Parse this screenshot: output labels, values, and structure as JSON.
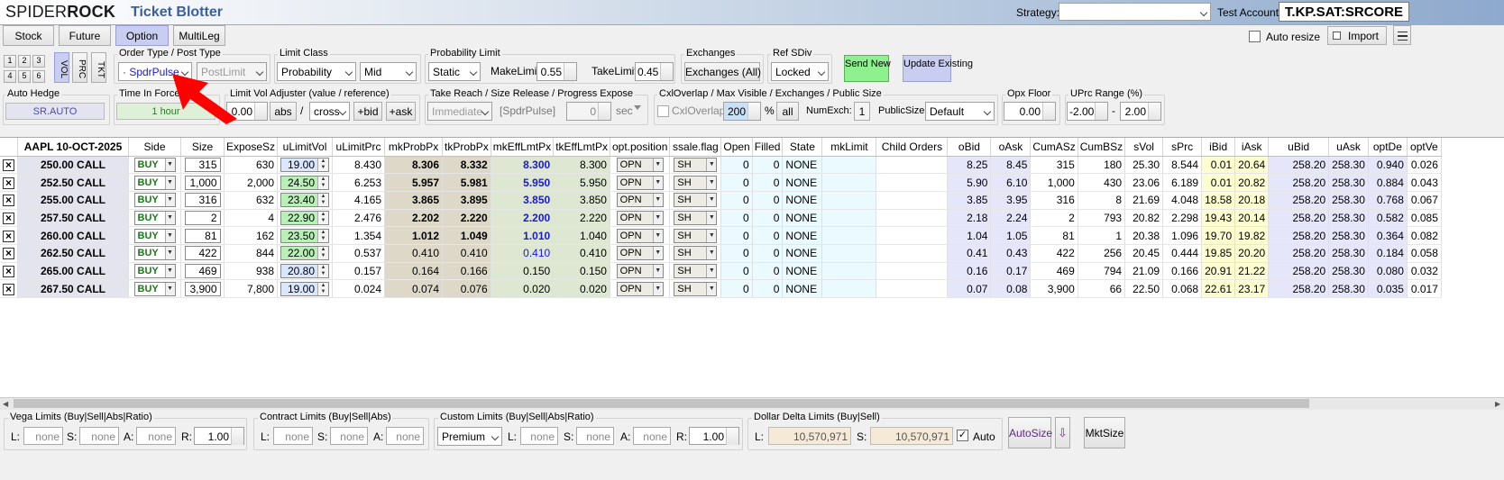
{
  "header": {
    "logo_light": "SPIDER",
    "logo_bold": "ROCK",
    "app_title": "Ticket Blotter",
    "strategy_label": "Strategy:",
    "strategy_value": "",
    "test_account_label": "Test Account:",
    "test_account_value": "T.KP.SAT:SRCORE"
  },
  "tabs": [
    {
      "label": "Stock",
      "active": false
    },
    {
      "label": "Future",
      "active": false
    },
    {
      "label": "Option",
      "active": true
    },
    {
      "label": "MultiLeg",
      "active": false
    }
  ],
  "toolbar_right": {
    "auto_resize_label": "Auto resize",
    "auto_resize_checked": false,
    "import_label": "Import"
  },
  "mini_buttons": [
    "1",
    "2",
    "3",
    "4",
    "5",
    "6"
  ],
  "vertical_tabs": [
    "VOL",
    "PRC",
    "TKT"
  ],
  "order_type": {
    "title": "Order Type / Post Type",
    "order_type_value": "· SpdrPulse",
    "post_type_value": "PostLimit"
  },
  "limit_class": {
    "title": "Limit Class",
    "class_value": "Probability",
    "ref_value": "Mid"
  },
  "probability_limit": {
    "title": "Probability Limit",
    "mode_value": "Static",
    "make_limit_label": "MakeLimit:",
    "make_limit_value": "0.55",
    "take_limit_label": "TakeLimit",
    "take_limit_value": "0.45"
  },
  "exchanges": {
    "title": "Exchanges",
    "button_label": "Exchanges (All)"
  },
  "ref_sdiv": {
    "title": "Ref SDiv",
    "value": "Locked"
  },
  "send_new_label": "Send New",
  "update_existing_label": "Update Existing",
  "auto_hedge": {
    "title": "Auto Hedge",
    "value": "SR.AUTO"
  },
  "time_in_force": {
    "title": "Time In Force",
    "value": "1 hour"
  },
  "limit_vol_adjuster": {
    "title": "Limit Vol Adjuster (value / reference)",
    "value": "0.00",
    "abs_label": "abs",
    "slash": "/",
    "ref_value": "cross",
    "bid_label": "+bid",
    "ask_label": "+ask"
  },
  "take_reach": {
    "title": "Take Reach / Size Release / Progress Expose",
    "reach_value": "Immediate",
    "release_value": "[SpdrPulse]",
    "expose_value": "0",
    "sec_label": "sec"
  },
  "cxl_overlap": {
    "title": "CxlOverlap / Max Visible / Exchanges / Public Size",
    "cxl_label": "CxlOverlap",
    "max_visible_value": "200",
    "percent_label": "%",
    "all_label": "all",
    "num_exch_label": "NumExch:",
    "num_exch_value": "1",
    "public_size_label": "PublicSize:",
    "public_size_value": "Default"
  },
  "opx_floor": {
    "title": "Opx Floor",
    "value": "0.00"
  },
  "uprc_range": {
    "title": "UPrc Range (%)",
    "low": "-2.00",
    "dash": "-",
    "high": "2.00"
  },
  "grid": {
    "columns": [
      "",
      "AAPL 10-OCT-2025",
      "Side",
      "Size",
      "ExposeSz",
      "uLimitVol",
      "uLimitPrc",
      "mkProbPx",
      "tkProbPx",
      "mkEffLmtPx",
      "tkEffLmtPx",
      "opt.position",
      "ssale.flag",
      "Open",
      "Filled",
      "State",
      "mkLimit",
      "Child Orders",
      "oBid",
      "oAsk",
      "CumASz",
      "CumBSz",
      "sVol",
      "sPrc",
      "iBid",
      "iAsk",
      "uBid",
      "uAsk",
      "optDe",
      "optVe"
    ],
    "rows": [
      {
        "symbol": "250.00 CALL",
        "side": "BUY",
        "size": "315",
        "expose": "630",
        "ulimitvol": "19.00",
        "ulimitprc": "8.430",
        "mkprob": "8.306",
        "tkprob": "8.332",
        "mkeff": "8.300",
        "tkeff": "8.300",
        "optpos": "OPN",
        "ssale": "SH",
        "open": "0",
        "filled": "0",
        "state": "NONE",
        "mklimit": "",
        "child": "",
        "obid": "8.25",
        "oask": "8.45",
        "cumasz": "315",
        "cumbsz": "180",
        "svol": "25.30",
        "sprc": "8.544",
        "ibid": "0.01",
        "iask": "20.64",
        "ubid": "258.20",
        "uask": "258.30",
        "optde": "0.940",
        "optve": "0.026"
      },
      {
        "symbol": "252.50 CALL",
        "side": "BUY",
        "size": "1,000",
        "expose": "2,000",
        "ulimitvol": "24.50",
        "ulimitprc": "6.253",
        "mkprob": "5.957",
        "tkprob": "5.981",
        "mkeff": "5.950",
        "tkeff": "5.950",
        "optpos": "OPN",
        "ssale": "SH",
        "open": "0",
        "filled": "0",
        "state": "NONE",
        "mklimit": "",
        "child": "",
        "obid": "5.90",
        "oask": "6.10",
        "cumasz": "1,000",
        "cumbsz": "430",
        "svol": "23.06",
        "sprc": "6.189",
        "ibid": "0.01",
        "iask": "20.82",
        "ubid": "258.20",
        "uask": "258.30",
        "optde": "0.884",
        "optve": "0.043"
      },
      {
        "symbol": "255.00 CALL",
        "side": "BUY",
        "size": "316",
        "expose": "632",
        "ulimitvol": "23.40",
        "ulimitprc": "4.165",
        "mkprob": "3.865",
        "tkprob": "3.895",
        "mkeff": "3.850",
        "tkeff": "3.850",
        "optpos": "OPN",
        "ssale": "SH",
        "open": "0",
        "filled": "0",
        "state": "NONE",
        "mklimit": "",
        "child": "",
        "obid": "3.85",
        "oask": "3.95",
        "cumasz": "316",
        "cumbsz": "8",
        "svol": "21.69",
        "sprc": "4.048",
        "ibid": "18.58",
        "iask": "20.18",
        "ubid": "258.20",
        "uask": "258.30",
        "optde": "0.768",
        "optve": "0.067"
      },
      {
        "symbol": "257.50 CALL",
        "side": "BUY",
        "size": "2",
        "expose": "4",
        "ulimitvol": "22.90",
        "ulimitprc": "2.476",
        "mkprob": "2.202",
        "tkprob": "2.220",
        "mkeff": "2.200",
        "tkeff": "2.220",
        "optpos": "OPN",
        "ssale": "SH",
        "open": "0",
        "filled": "0",
        "state": "NONE",
        "mklimit": "",
        "child": "",
        "obid": "2.18",
        "oask": "2.24",
        "cumasz": "2",
        "cumbsz": "793",
        "svol": "20.82",
        "sprc": "2.298",
        "ibid": "19.43",
        "iask": "20.14",
        "ubid": "258.20",
        "uask": "258.30",
        "optde": "0.582",
        "optve": "0.085"
      },
      {
        "symbol": "260.00 CALL",
        "side": "BUY",
        "size": "81",
        "expose": "162",
        "ulimitvol": "23.50",
        "ulimitprc": "1.354",
        "mkprob": "1.012",
        "tkprob": "1.049",
        "mkeff": "1.010",
        "tkeff": "1.040",
        "optpos": "OPN",
        "ssale": "SH",
        "open": "0",
        "filled": "0",
        "state": "NONE",
        "mklimit": "",
        "child": "",
        "obid": "1.04",
        "oask": "1.05",
        "cumasz": "81",
        "cumbsz": "1",
        "svol": "20.38",
        "sprc": "1.096",
        "ibid": "19.70",
        "iask": "19.82",
        "ubid": "258.20",
        "uask": "258.30",
        "optde": "0.364",
        "optve": "0.082"
      },
      {
        "symbol": "262.50 CALL",
        "side": "BUY",
        "size": "422",
        "expose": "844",
        "ulimitvol": "22.00",
        "ulimitprc": "0.537",
        "mkprob": "0.410",
        "tkprob": "0.410",
        "mkeff": "0.410",
        "tkeff": "0.410",
        "optpos": "OPN",
        "ssale": "SH",
        "open": "0",
        "filled": "0",
        "state": "NONE",
        "mklimit": "",
        "child": "",
        "obid": "0.41",
        "oask": "0.43",
        "cumasz": "422",
        "cumbsz": "256",
        "svol": "20.45",
        "sprc": "0.444",
        "ibid": "19.85",
        "iask": "20.20",
        "ubid": "258.20",
        "uask": "258.30",
        "optde": "0.184",
        "optve": "0.058"
      },
      {
        "symbol": "265.00 CALL",
        "side": "BUY",
        "size": "469",
        "expose": "938",
        "ulimitvol": "20.80",
        "ulimitprc": "0.157",
        "mkprob": "0.164",
        "tkprob": "0.166",
        "mkeff": "0.150",
        "tkeff": "0.150",
        "optpos": "OPN",
        "ssale": "SH",
        "open": "0",
        "filled": "0",
        "state": "NONE",
        "mklimit": "",
        "child": "",
        "obid": "0.16",
        "oask": "0.17",
        "cumasz": "469",
        "cumbsz": "794",
        "svol": "21.09",
        "sprc": "0.166",
        "ibid": "20.91",
        "iask": "21.22",
        "ubid": "258.20",
        "uask": "258.30",
        "optde": "0.080",
        "optve": "0.032"
      },
      {
        "symbol": "267.50 CALL",
        "side": "BUY",
        "size": "3,900",
        "expose": "7,800",
        "ulimitvol": "19.00",
        "ulimitprc": "0.024",
        "mkprob": "0.074",
        "tkprob": "0.076",
        "mkeff": "0.020",
        "tkeff": "0.020",
        "optpos": "OPN",
        "ssale": "SH",
        "open": "0",
        "filled": "0",
        "state": "NONE",
        "mklimit": "",
        "child": "",
        "obid": "0.07",
        "oask": "0.08",
        "cumasz": "3,900",
        "cumbsz": "66",
        "svol": "22.50",
        "sprc": "0.068",
        "ibid": "22.61",
        "iask": "23.17",
        "ubid": "258.20",
        "uask": "258.30",
        "optde": "0.035",
        "optve": "0.017"
      }
    ]
  },
  "limits": {
    "vega": {
      "title": "Vega Limits (Buy|Sell|Abs|Ratio)",
      "l_label": "L:",
      "l": "none",
      "s_label": "S:",
      "s": "none",
      "a_label": "A:",
      "a": "none",
      "r_label": "R:",
      "r": "1.00"
    },
    "contract": {
      "title": "Contract Limits (Buy|Sell|Abs)",
      "l_label": "L:",
      "l": "none",
      "s_label": "S:",
      "s": "none",
      "a_label": "A:",
      "a": "none"
    },
    "custom": {
      "title": "Custom Limits (Buy|Sell|Abs|Ratio)",
      "type": "Premium",
      "l_label": "L:",
      "l": "none",
      "s_label": "S:",
      "s": "none",
      "a_label": "A:",
      "a": "none",
      "r_label": "R:",
      "r": "1.00"
    },
    "dollar_delta": {
      "title": "Dollar Delta Limits (Buy|Sell)",
      "l_label": "L:",
      "l": "10,570,971",
      "s_label": "S:",
      "s": "10,570,971",
      "auto_label": "Auto",
      "auto_checked": true
    },
    "autosize_label": "AutoSize",
    "mktsize_label": "MktSize"
  },
  "colors": {
    "accent_title": "#3a5f9a",
    "active_tab": "#c9cdf0",
    "send_green": "#8ef08e",
    "update_lavender": "#c9cdf0",
    "annotation_arrow": "#ff0000"
  }
}
